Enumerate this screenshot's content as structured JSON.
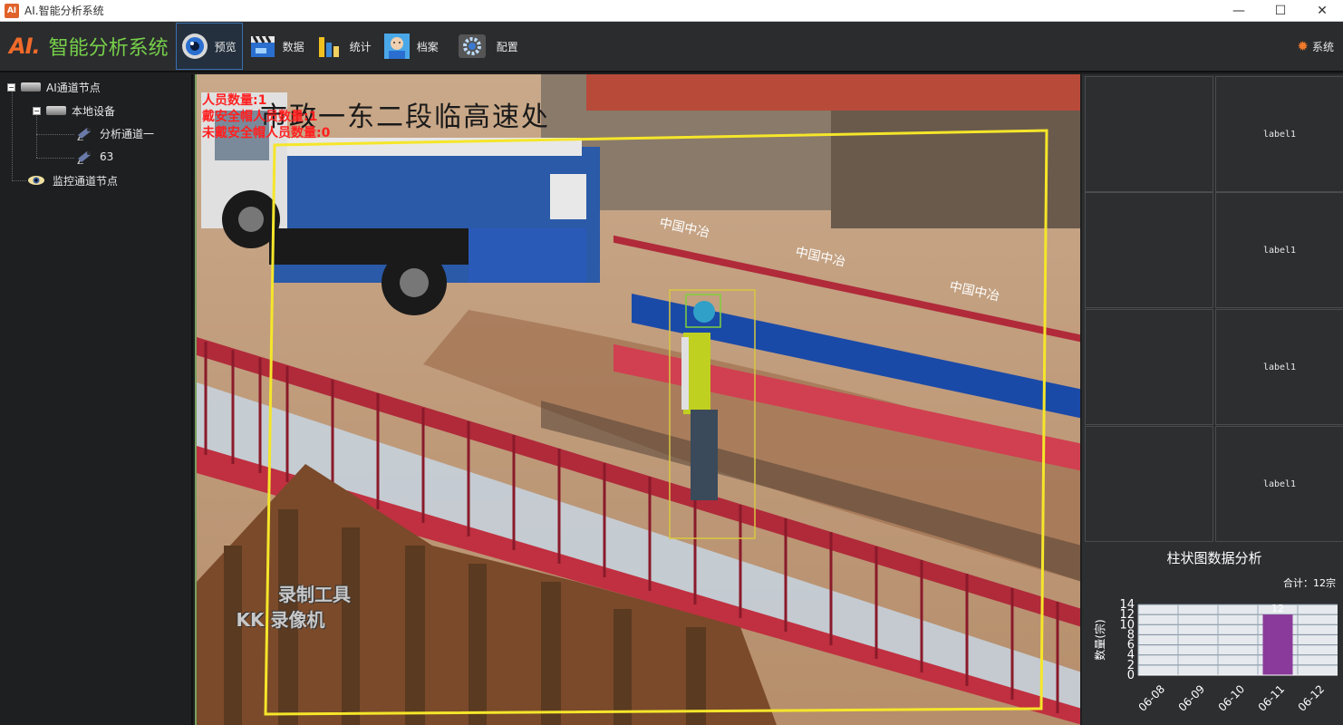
{
  "window": {
    "title": "AI.智能分析系统",
    "icon_text": "AI",
    "minimize": "—",
    "maximize": "☐",
    "close": "✕"
  },
  "toolbar": {
    "logo_mark": "AI.",
    "logo_text": "智能分析系统",
    "buttons": [
      {
        "label": "预览",
        "icon": "preview-camera-icon",
        "active": true
      },
      {
        "label": "数据",
        "icon": "clapperboard-icon",
        "active": false
      },
      {
        "label": "统计",
        "icon": "bar-stats-icon",
        "active": false
      },
      {
        "label": "档案",
        "icon": "profile-face-icon",
        "active": false
      },
      {
        "label": "配置",
        "icon": "gear-config-icon",
        "active": false
      }
    ],
    "system_label": "系统",
    "system_icon": "gear-icon"
  },
  "tree": {
    "root": "AI通道节点",
    "device": "本地设备",
    "channel_1": "分析通道一",
    "channel_2": "63",
    "monitor": "监控通道节点",
    "collapse_glyph": "−"
  },
  "video": {
    "overlay_lines": [
      "人员数量:1",
      "戴安全帽人员数量:1",
      "未戴安全帽人员数量:0"
    ],
    "scene_text": "市政一东二段临高速处",
    "fence_text": "中国中冶",
    "watermark_1": "录制工具",
    "watermark_2": "KK 录像机",
    "colors": {
      "zone_box": "#f5e62a",
      "person_box": "#d8c840",
      "helmet_box": "#7fd03a",
      "alert_text": "#ff2020"
    }
  },
  "right_panel": {
    "cells": [
      "label1",
      "label1",
      "label1",
      "label1"
    ],
    "chart_title": "柱状图数据分析",
    "chart_total": "合计：12宗"
  },
  "chart_data": {
    "type": "bar",
    "categories": [
      "06-08",
      "06-09",
      "06-10",
      "06-11",
      "06-12"
    ],
    "values": [
      0,
      0,
      0,
      12,
      0
    ],
    "ylabel": "数量(宗)",
    "ylim": [
      0,
      14
    ],
    "yticks": [
      0,
      2,
      4,
      6,
      8,
      10,
      12,
      14
    ],
    "data_labels": [
      "",
      "",
      "",
      "12",
      ""
    ],
    "bar_color": "#8a3a9a",
    "grid": true
  }
}
